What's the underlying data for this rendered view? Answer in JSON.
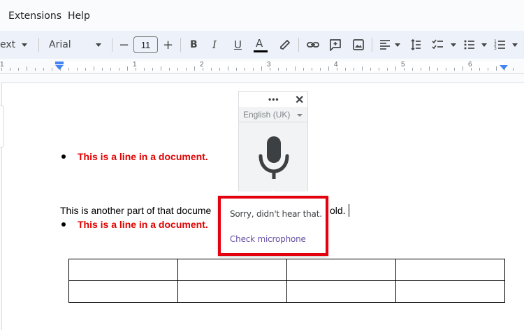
{
  "menubar": {
    "items": [
      "Extensions",
      "Help"
    ]
  },
  "toolbar": {
    "style_label": "ext",
    "font_label": "Arial",
    "font_size": "11",
    "minus": "−",
    "plus": "+",
    "bold": "B",
    "italic": "I",
    "underline": "U",
    "text_color": "A",
    "text_color_bar": "#000000"
  },
  "ruler": {
    "numbers": [
      "1",
      "1",
      "2",
      "3",
      "4",
      "5",
      "6"
    ]
  },
  "document": {
    "bullet_line_1": "This is a line in a document.",
    "body_text_left": "This is another part of that docume",
    "body_text_right": "old.",
    "bullet_line_2": "This is a line in a document.",
    "table_rows": [
      [
        "",
        "",
        "",
        ""
      ],
      [
        "",
        "",
        "",
        ""
      ]
    ],
    "accent_red": "#e00000"
  },
  "voice_typing": {
    "menu_dots": "•••",
    "close": "✕",
    "language": "English (UK)",
    "mic_icon": "microphone-icon"
  },
  "voice_error_popup": {
    "message": "Sorry, didn't hear that.",
    "link": "Check microphone",
    "highlight_color": "#e3000f"
  }
}
